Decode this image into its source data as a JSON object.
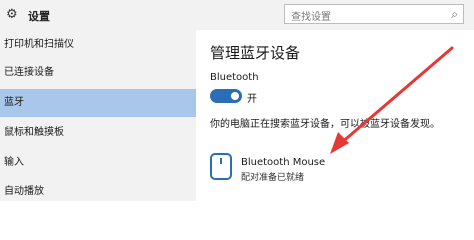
{
  "app": {
    "title": "设置"
  },
  "search": {
    "placeholder": "查找设置"
  },
  "sidebar": {
    "items": [
      {
        "label": "打印机和扫描仪"
      },
      {
        "label": "已连接设备"
      },
      {
        "label": "蓝牙",
        "active": true
      },
      {
        "label": "鼠标和触摸板"
      },
      {
        "label": "输入"
      },
      {
        "label": "自动播放"
      }
    ]
  },
  "main": {
    "title": "管理蓝牙设备",
    "bluetooth_label": "Bluetooth",
    "toggle_state": "开",
    "status_text": "你的电脑正在搜索蓝牙设备，可以被蓝牙设备发现。",
    "device": {
      "name": "Bluetooth Mouse",
      "status": "配对准备已就绪"
    }
  },
  "colors": {
    "accent": "#2a6fb5",
    "sidebar_active": "#a8c7ea",
    "annotation_arrow": "#e53935"
  },
  "icons": {
    "app": "gear-icon",
    "search": "search-icon",
    "device": "mouse-icon",
    "annotation": "red-arrow-annotation"
  }
}
